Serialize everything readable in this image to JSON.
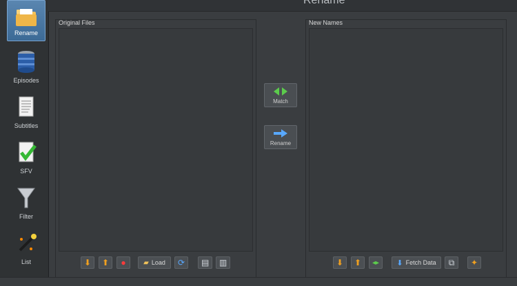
{
  "window": {
    "title": "Rename"
  },
  "sidebar": {
    "items": [
      {
        "label": "Rename",
        "icon": "folder-icon",
        "active": true
      },
      {
        "label": "Episodes",
        "icon": "database-icon"
      },
      {
        "label": "Subtitles",
        "icon": "document-icon"
      },
      {
        "label": "SFV",
        "icon": "checkmark-document-icon"
      },
      {
        "label": "Filter",
        "icon": "funnel-icon"
      },
      {
        "label": "List",
        "icon": "wand-icon"
      }
    ]
  },
  "left_panel": {
    "title": "Original Files",
    "load_label": "Load"
  },
  "right_panel": {
    "title": "New Names",
    "fetch_label": "Fetch Data"
  },
  "center": {
    "match_label": "Match",
    "rename_label": "Rename"
  },
  "colors": {
    "accent": "#4a7db0",
    "green": "#5ccc4c",
    "orange": "#f0a020",
    "blue": "#58a8ff"
  }
}
